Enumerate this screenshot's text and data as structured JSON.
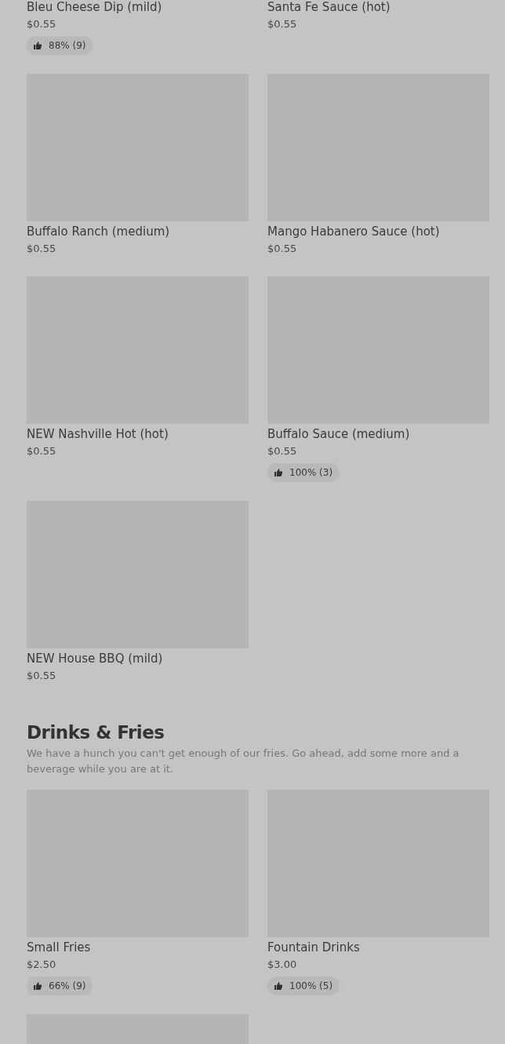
{
  "sections": [
    {
      "items": [
        {
          "image_visible": false,
          "name": "Bleu Cheese Dip (mild)",
          "price": "$0.55",
          "rating": "88% (9)"
        },
        {
          "image_visible": false,
          "name": "Santa Fe Sauce (hot)",
          "price": "$0.55"
        },
        {
          "image_visible": true,
          "name": "Buffalo Ranch (medium)",
          "price": "$0.55"
        },
        {
          "image_visible": true,
          "name": "Mango Habanero Sauce (hot)",
          "price": "$0.55"
        },
        {
          "image_visible": true,
          "name": "NEW Nashville Hot (hot)",
          "price": "$0.55"
        },
        {
          "image_visible": true,
          "name": "Buffalo Sauce (medium)",
          "price": "$0.55",
          "rating": "100% (3)"
        },
        {
          "image_visible": true,
          "name": "NEW House BBQ (mild)",
          "price": "$0.55"
        }
      ]
    },
    {
      "title": "Drinks & Fries",
      "description": "We have a hunch you can't get enough of our fries. Go ahead, add some more and a beverage while you are at it.",
      "items": [
        {
          "image_visible": true,
          "name": "Small Fries",
          "price": "$2.50",
          "rating": "66% (9)"
        },
        {
          "image_visible": true,
          "name": "Fountain Drinks",
          "price": "$3.00",
          "rating": "100% (5)"
        },
        {
          "image_visible": true
        }
      ]
    }
  ]
}
